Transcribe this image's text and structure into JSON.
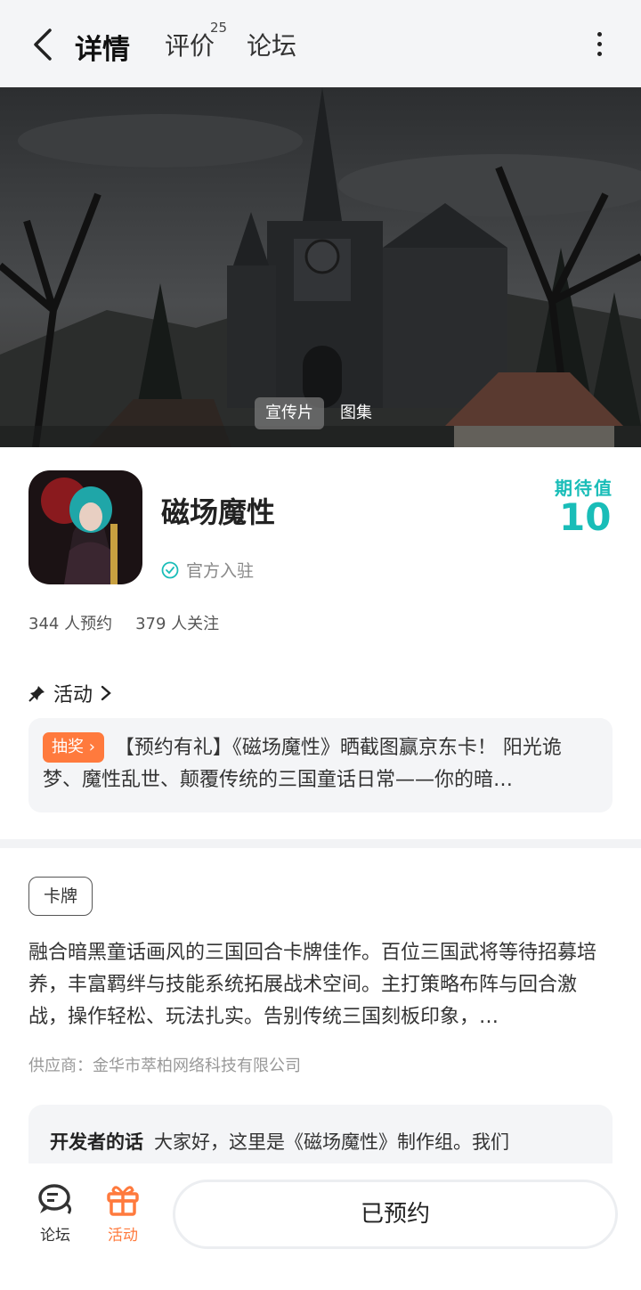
{
  "nav": {
    "tabs": [
      {
        "label": "详情",
        "active": true
      },
      {
        "label": "评价",
        "badge": "25"
      },
      {
        "label": "论坛"
      }
    ],
    "accent_color": "#19c3c0"
  },
  "media": {
    "tabs": [
      "宣传片",
      "图集"
    ]
  },
  "app": {
    "name": "磁场魔性",
    "official_label": "官方入驻",
    "expect_label": "期待值",
    "expect_value": "10",
    "reservations": "344 人预约",
    "followers": "379 人关注"
  },
  "activity": {
    "header": "活动",
    "tag": "抽奖",
    "text": "【预约有礼】《磁场魔性》晒截图赢京东卡！ 阳光诡梦、魔性乱世、颠覆传统的三国童话日常——你的暗…"
  },
  "details": {
    "genre_tag": "卡牌",
    "description": "融合暗黑童话画风的三国回合卡牌佳作。百位三国武将等待招募培养，丰富羁绊与技能系统拓展战术空间。主打策略布阵与回合激战，操作轻松、玩法扎实。告别传统三国刻板印象，…",
    "supplier": "供应商：金华市萃柏网络科技有限公司",
    "dev_label": "开发者的话",
    "dev_text": "大家好，这里是《磁场魔性》制作组。我们"
  },
  "bottom": {
    "forum_label": "论坛",
    "activity_label": "活动",
    "reserve_label": "已预约",
    "activity_color": "#ff7a3d"
  }
}
